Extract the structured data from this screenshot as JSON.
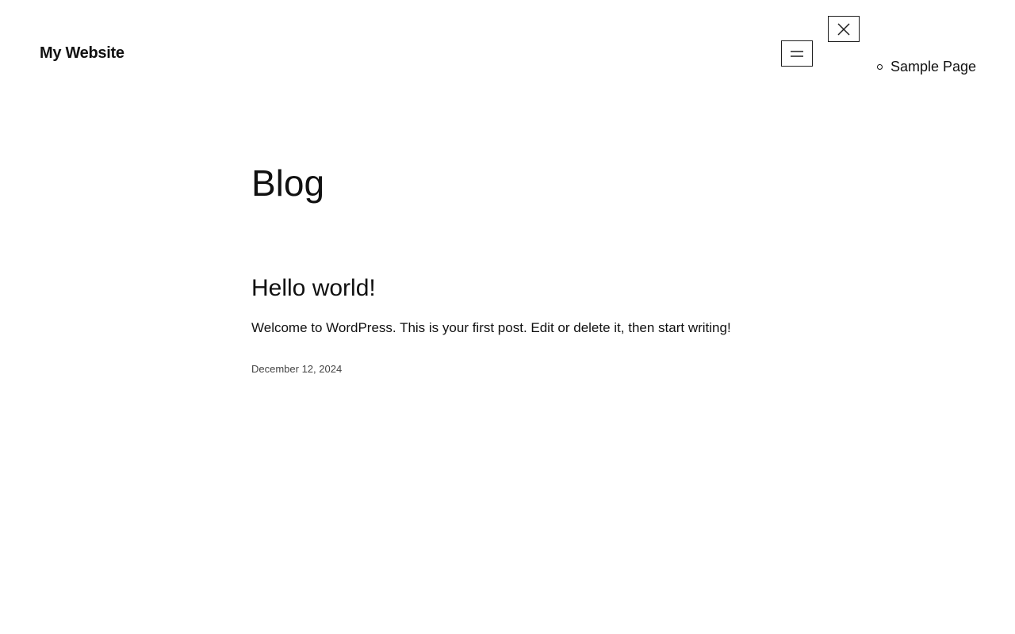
{
  "header": {
    "site_title": "My Website"
  },
  "navigation": {
    "open_icon": "hamburger-icon",
    "close_icon": "close-icon",
    "items": [
      {
        "label": "Sample Page"
      }
    ]
  },
  "main": {
    "page_title": "Blog",
    "posts": [
      {
        "title": "Hello world!",
        "excerpt": "Welcome to WordPress. This is your first post. Edit or delete it, then start writing!",
        "date": "December 12, 2024"
      }
    ]
  }
}
